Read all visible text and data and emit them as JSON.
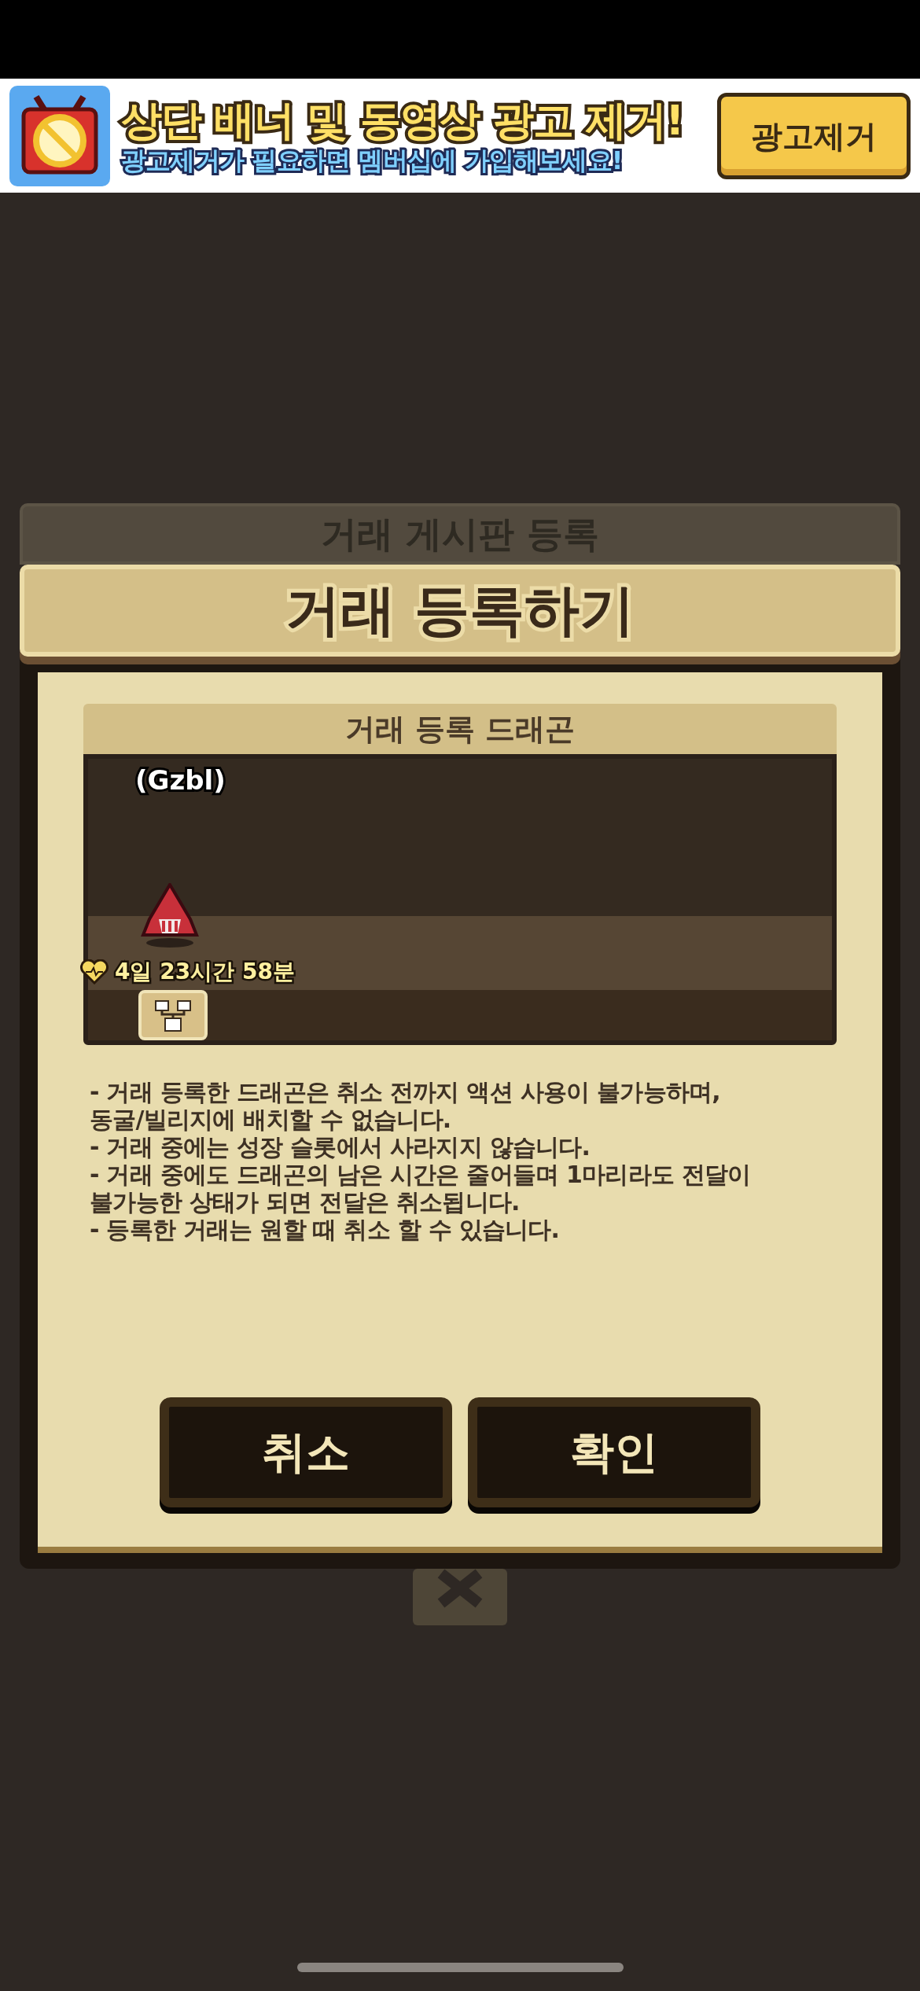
{
  "banner": {
    "title": "상단 배너 및 동영상 광고 제거!",
    "subtitle": "광고제거가 필요하면 멤버십에 가입해보세요!",
    "button": "광고제거"
  },
  "back_dialog": {
    "title": "거래 게시판 등록"
  },
  "dialog": {
    "title": "거래 등록하기",
    "section_title": "거래 등록 드래곤",
    "dragon": {
      "name": "(Gzbl)",
      "timer": "4일 23시간 58분"
    },
    "notes": [
      "- 거래 등록한 드래곤은 취소 전까지 액션 사용이 불가능하며, 동굴/빌리지에 배치할 수 없습니다.",
      "- 거래 중에는 성장 슬롯에서 사라지지 않습니다.",
      "- 거래 중에도 드래곤의 남은 시간은 줄어들며 1마리라도 전달이 불가능한 상태가 되면 전달은 취소됩니다.",
      "- 등록한 거래는 원할 때 취소 할 수 있습니다."
    ],
    "buttons": [
      "취소",
      "확인"
    ]
  }
}
